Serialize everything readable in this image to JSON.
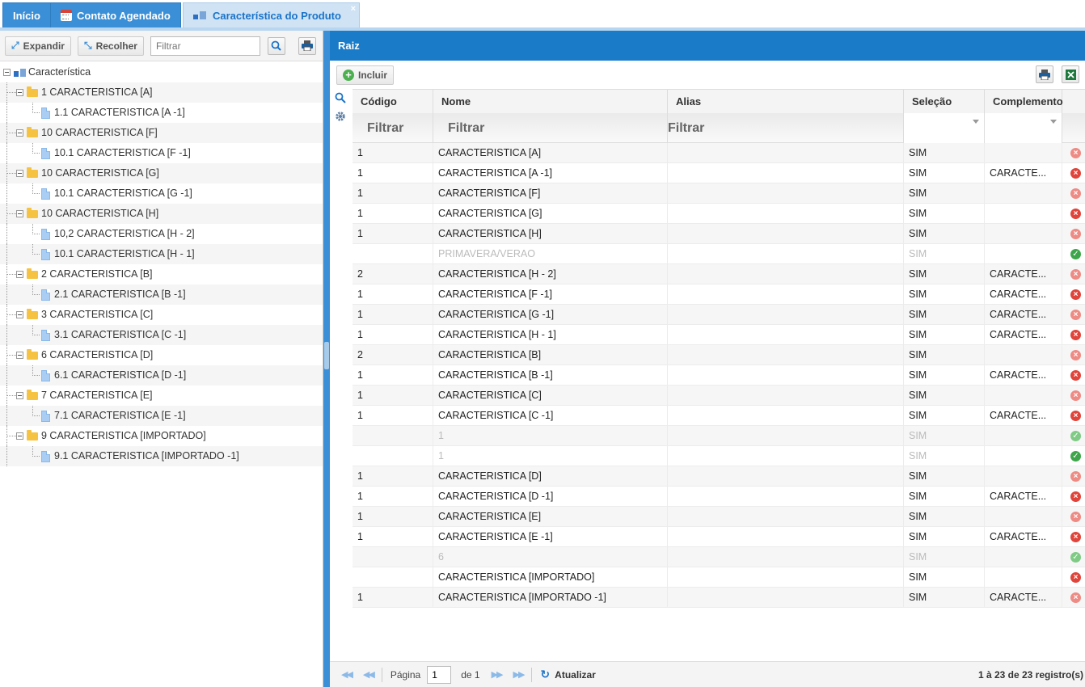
{
  "tabs": [
    {
      "label": "Início"
    },
    {
      "label": "Contato Agendado"
    },
    {
      "label": "Característica do Produto",
      "close": "×"
    }
  ],
  "left": {
    "expand_label": "Expandir",
    "collapse_label": "Recolher",
    "filter_placeholder": "Filtrar",
    "tree": [
      {
        "label": "Característica",
        "level": 0,
        "kind": "root"
      },
      {
        "label": "1 CARACTERISTICA [A]",
        "level": 1,
        "kind": "folder"
      },
      {
        "label": "1.1 CARACTERISTICA [A -1]",
        "level": 2,
        "kind": "doc"
      },
      {
        "label": "10 CARACTERISTICA [F]",
        "level": 1,
        "kind": "folder"
      },
      {
        "label": "10.1 CARACTERISTICA [F -1]",
        "level": 2,
        "kind": "doc"
      },
      {
        "label": "10 CARACTERISTICA [G]",
        "level": 1,
        "kind": "folder"
      },
      {
        "label": "10.1 CARACTERISTICA [G -1]",
        "level": 2,
        "kind": "doc"
      },
      {
        "label": "10 CARACTERISTICA [H]",
        "level": 1,
        "kind": "folder"
      },
      {
        "label": "10,2 CARACTERISTICA [H - 2]",
        "level": 2,
        "kind": "doc"
      },
      {
        "label": "10.1 CARACTERISTICA [H - 1]",
        "level": 2,
        "kind": "doc"
      },
      {
        "label": "2 CARACTERISTICA [B]",
        "level": 1,
        "kind": "folder"
      },
      {
        "label": "2.1 CARACTERISTICA [B -1]",
        "level": 2,
        "kind": "doc"
      },
      {
        "label": "3 CARACTERISTICA [C]",
        "level": 1,
        "kind": "folder"
      },
      {
        "label": "3.1 CARACTERISTICA [C -1]",
        "level": 2,
        "kind": "doc"
      },
      {
        "label": "6 CARACTERISTICA [D]",
        "level": 1,
        "kind": "folder"
      },
      {
        "label": "6.1 CARACTERISTICA [D -1]",
        "level": 2,
        "kind": "doc"
      },
      {
        "label": "7 CARACTERISTICA [E]",
        "level": 1,
        "kind": "folder"
      },
      {
        "label": "7.1 CARACTERISTICA [E -1]",
        "level": 2,
        "kind": "doc"
      },
      {
        "label": "9 CARACTERISTICA [IMPORTADO]",
        "level": 1,
        "kind": "folder"
      },
      {
        "label": "9.1 CARACTERISTICA [IMPORTADO -1]",
        "level": 2,
        "kind": "doc"
      }
    ]
  },
  "right": {
    "title": "Raiz",
    "add_label": "Incluir",
    "columns": [
      "Código",
      "Nome",
      "Alias",
      "Seleção",
      "Complemento"
    ],
    "filter_labels": [
      "Filtrar",
      "Filtrar",
      "Filtrar"
    ],
    "rows": [
      {
        "codigo": "1",
        "nome": "CARACTERISTICA [A]",
        "alias": "",
        "selecao": "SIM",
        "complemento": "",
        "status": "remove",
        "dim": false
      },
      {
        "codigo": "1",
        "nome": "CARACTERISTICA [A -1]",
        "alias": "",
        "selecao": "SIM",
        "complemento": "CARACTE...",
        "status": "remove",
        "dim": false
      },
      {
        "codigo": "1",
        "nome": "CARACTERISTICA [F]",
        "alias": "",
        "selecao": "SIM",
        "complemento": "",
        "status": "remove",
        "dim": false
      },
      {
        "codigo": "1",
        "nome": "CARACTERISTICA [G]",
        "alias": "",
        "selecao": "SIM",
        "complemento": "",
        "status": "remove",
        "dim": false
      },
      {
        "codigo": "1",
        "nome": "CARACTERISTICA [H]",
        "alias": "",
        "selecao": "SIM",
        "complemento": "",
        "status": "remove",
        "dim": false
      },
      {
        "codigo": "",
        "nome": "PRIMAVERA/VERAO",
        "alias": "",
        "selecao": "SIM",
        "complemento": "",
        "status": "active",
        "dim": true
      },
      {
        "codigo": "2",
        "nome": "CARACTERISTICA [H - 2]",
        "alias": "",
        "selecao": "SIM",
        "complemento": "CARACTE...",
        "status": "remove",
        "dim": false
      },
      {
        "codigo": "1",
        "nome": "CARACTERISTICA [F -1]",
        "alias": "",
        "selecao": "SIM",
        "complemento": "CARACTE...",
        "status": "remove",
        "dim": false
      },
      {
        "codigo": "1",
        "nome": "CARACTERISTICA [G -1]",
        "alias": "",
        "selecao": "SIM",
        "complemento": "CARACTE...",
        "status": "remove",
        "dim": false
      },
      {
        "codigo": "1",
        "nome": "CARACTERISTICA [H - 1]",
        "alias": "",
        "selecao": "SIM",
        "complemento": "CARACTE...",
        "status": "remove",
        "dim": false
      },
      {
        "codigo": "2",
        "nome": "CARACTERISTICA [B]",
        "alias": "",
        "selecao": "SIM",
        "complemento": "",
        "status": "remove",
        "dim": false
      },
      {
        "codigo": "1",
        "nome": "CARACTERISTICA [B -1]",
        "alias": "",
        "selecao": "SIM",
        "complemento": "CARACTE...",
        "status": "remove",
        "dim": false
      },
      {
        "codigo": "1",
        "nome": "CARACTERISTICA [C]",
        "alias": "",
        "selecao": "SIM",
        "complemento": "",
        "status": "remove",
        "dim": false
      },
      {
        "codigo": "1",
        "nome": "CARACTERISTICA [C -1]",
        "alias": "",
        "selecao": "SIM",
        "complemento": "CARACTE...",
        "status": "remove",
        "dim": false
      },
      {
        "codigo": "",
        "nome": "1",
        "alias": "",
        "selecao": "SIM",
        "complemento": "",
        "status": "active",
        "dim": true
      },
      {
        "codigo": "",
        "nome": "1",
        "alias": "",
        "selecao": "SIM",
        "complemento": "",
        "status": "active",
        "dim": true
      },
      {
        "codigo": "1",
        "nome": "CARACTERISTICA [D]",
        "alias": "",
        "selecao": "SIM",
        "complemento": "",
        "status": "remove",
        "dim": false
      },
      {
        "codigo": "1",
        "nome": "CARACTERISTICA [D -1]",
        "alias": "",
        "selecao": "SIM",
        "complemento": "CARACTE...",
        "status": "remove",
        "dim": false
      },
      {
        "codigo": "1",
        "nome": "CARACTERISTICA [E]",
        "alias": "",
        "selecao": "SIM",
        "complemento": "",
        "status": "remove",
        "dim": false
      },
      {
        "codigo": "1",
        "nome": "CARACTERISTICA [E -1]",
        "alias": "",
        "selecao": "SIM",
        "complemento": "CARACTE...",
        "status": "remove",
        "dim": false
      },
      {
        "codigo": "",
        "nome": "6",
        "alias": "",
        "selecao": "SIM",
        "complemento": "",
        "status": "active",
        "dim": true
      },
      {
        "codigo": "",
        "nome": "CARACTERISTICA [IMPORTADO]",
        "alias": "",
        "selecao": "SIM",
        "complemento": "",
        "status": "remove",
        "dim": false
      },
      {
        "codigo": "1",
        "nome": "CARACTERISTICA [IMPORTADO -1]",
        "alias": "",
        "selecao": "SIM",
        "complemento": "CARACTE...",
        "status": "remove",
        "dim": false
      }
    ]
  },
  "pager": {
    "page_label": "Página",
    "page_value": "1",
    "of_label": "de 1",
    "refresh_label": "Atualizar",
    "count_label": "1 à 23 de 23 registro(s)"
  },
  "colors": {
    "header_blue": "#1a7bc9",
    "tab_blue": "#3b8fd6",
    "remove_red": "#e0443a",
    "ok_green": "#3ea64a"
  }
}
